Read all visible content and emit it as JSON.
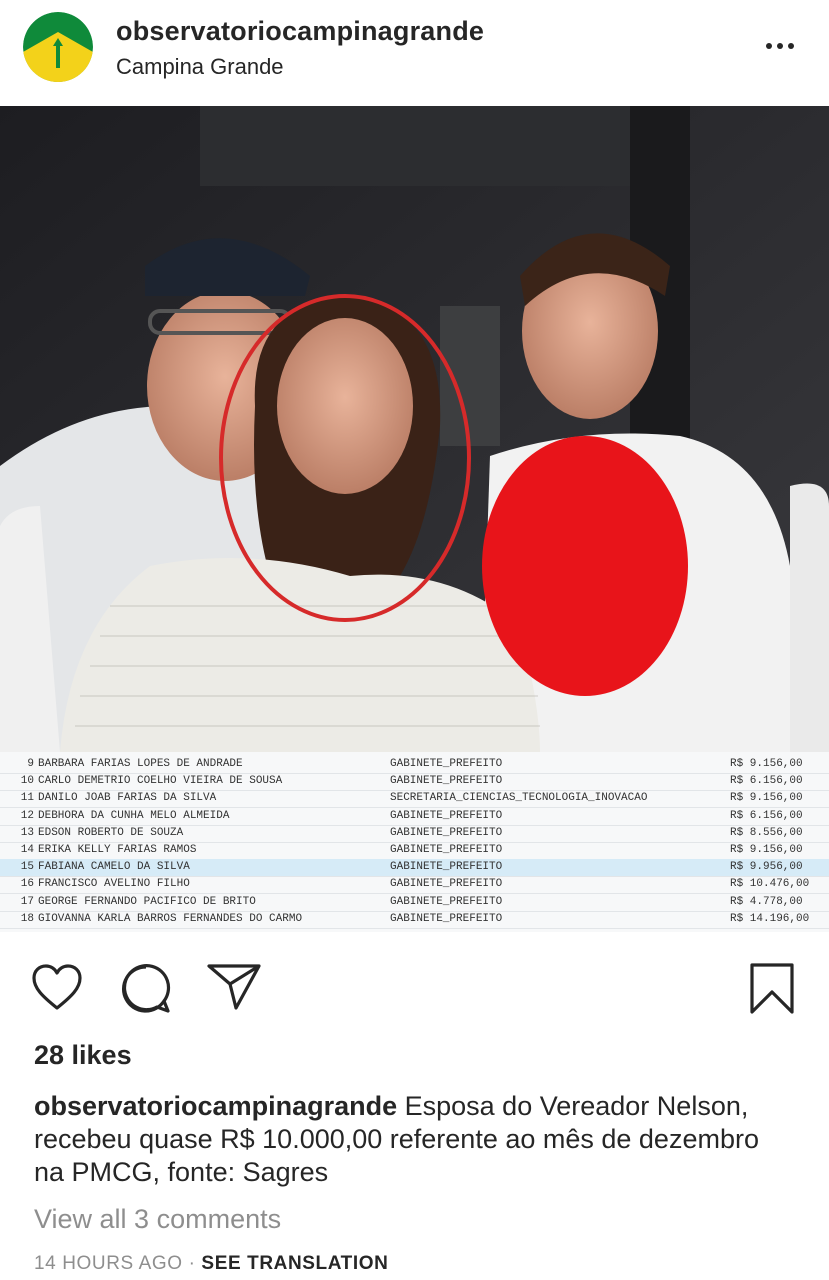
{
  "header": {
    "username": "observatoriocampinagrande",
    "location": "Campina Grande"
  },
  "sheet": {
    "rows": [
      {
        "num": "9",
        "name": "BARBARA FARIAS LOPES DE ANDRADE",
        "dept": "GABINETE_PREFEITO",
        "value": "R$ 9.156,00"
      },
      {
        "num": "10",
        "name": "CARLO DEMETRIO COELHO VIEIRA DE SOUSA",
        "dept": "GABINETE_PREFEITO",
        "value": "R$ 6.156,00"
      },
      {
        "num": "11",
        "name": "DANILO JOAB FARIAS DA SILVA",
        "dept": "SECRETARIA_CIENCIAS_TECNOLOGIA_INOVACAO",
        "value": "R$ 9.156,00"
      },
      {
        "num": "12",
        "name": "DEBHORA DA CUNHA MELO ALMEIDA",
        "dept": "GABINETE_PREFEITO",
        "value": "R$ 6.156,00"
      },
      {
        "num": "13",
        "name": "EDSON ROBERTO DE SOUZA",
        "dept": "GABINETE_PREFEITO",
        "value": "R$ 8.556,00"
      },
      {
        "num": "14",
        "name": "ERIKA KELLY FARIAS RAMOS",
        "dept": "GABINETE_PREFEITO",
        "value": "R$ 9.156,00"
      },
      {
        "num": "15",
        "name": "FABIANA CAMELO DA SILVA",
        "dept": "GABINETE_PREFEITO",
        "value": "R$ 9.956,00"
      },
      {
        "num": "16",
        "name": "FRANCISCO AVELINO FILHO",
        "dept": "GABINETE_PREFEITO",
        "value": "R$ 10.476,00"
      },
      {
        "num": "17",
        "name": "GEORGE FERNANDO PACIFICO DE BRITO",
        "dept": "GABINETE_PREFEITO",
        "value": "R$ 4.778,00"
      },
      {
        "num": "18",
        "name": "GIOVANNA KARLA BARROS FERNANDES DO CARMO",
        "dept": "GABINETE_PREFEITO",
        "value": "R$ 14.196,00"
      }
    ]
  },
  "actions": {
    "icons": [
      "heart-icon",
      "comment-icon",
      "share-icon",
      "bookmark-icon"
    ]
  },
  "post": {
    "likes": "28 likes",
    "caption_user": "observatoriocampinagrande",
    "caption_text": "Esposa do Vereador Nelson, recebeu quase R$ 10.000,00 referente ao mês de dezembro na PMCG, fonte: Sagres",
    "view_comments": "View all 3 comments",
    "timestamp": "14 HOURS AGO",
    "separator": "·",
    "see_translation": "SEE TRANSLATION"
  },
  "colors": {
    "text": "#262626",
    "muted": "#8e8e8e",
    "highlight_row": "#d6ebf7",
    "circle": "#d62a2a",
    "blur_blob": "#e8141a",
    "avatar_green": "#0f8a3a",
    "avatar_yellow": "#f3d21a"
  }
}
